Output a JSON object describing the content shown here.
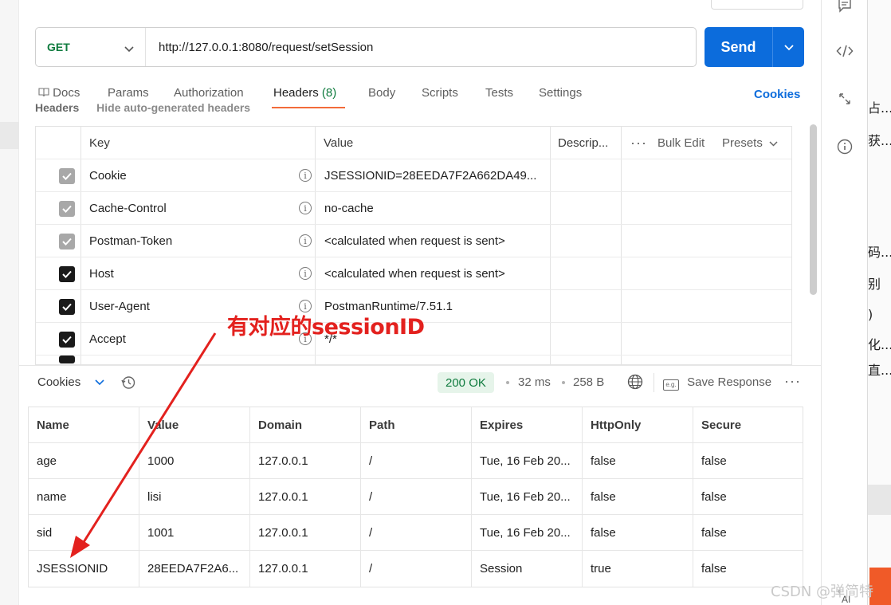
{
  "request": {
    "method": "GET",
    "url": "http://127.0.0.1:8080/request/setSession",
    "send_label": "Send"
  },
  "tabs": [
    {
      "label": "Docs"
    },
    {
      "label": "Params"
    },
    {
      "label": "Authorization"
    },
    {
      "label": "Headers",
      "count": "(8)"
    },
    {
      "label": "Body"
    },
    {
      "label": "Scripts"
    },
    {
      "label": "Tests"
    },
    {
      "label": "Settings"
    }
  ],
  "cookies_link": "Cookies",
  "headers_section": {
    "title": "Headers",
    "toggle_label": "Hide auto-generated headers"
  },
  "headers_table": {
    "columns": {
      "key": "Key",
      "value": "Value",
      "description": "Descrip...",
      "bulk_edit": "Bulk Edit",
      "presets": "Presets"
    },
    "rows": [
      {
        "key": "Cookie",
        "value": "JSESSIONID=28EEDA7F2A662DA49..."
      },
      {
        "key": "Cache-Control",
        "value": "no-cache"
      },
      {
        "key": "Postman-Token",
        "value": "<calculated when request is sent>"
      },
      {
        "key": "Host",
        "value": "<calculated when request is sent>"
      },
      {
        "key": "User-Agent",
        "value": "PostmanRuntime/7.51.1"
      },
      {
        "key": "Accept",
        "value": "*/*"
      }
    ]
  },
  "response_bar": {
    "tab": "Cookies",
    "status": "200 OK",
    "time": "32 ms",
    "size": "258 B",
    "save_label": "Save Response"
  },
  "cookies_table": {
    "columns": [
      "Name",
      "Value",
      "Domain",
      "Path",
      "Expires",
      "HttpOnly",
      "Secure"
    ],
    "rows": [
      [
        "age",
        "1000",
        "127.0.0.1",
        "/",
        "Tue, 16 Feb 20...",
        "false",
        "false"
      ],
      [
        "name",
        "lisi",
        "127.0.0.1",
        "/",
        "Tue, 16 Feb 20...",
        "false",
        "false"
      ],
      [
        "sid",
        "1001",
        "127.0.0.1",
        "/",
        "Tue, 16 Feb 20...",
        "false",
        "false"
      ],
      [
        "JSESSIONID",
        "28EEDA7F2A6...",
        "127.0.0.1",
        "/",
        "Session",
        "true",
        "false"
      ]
    ]
  },
  "annotation": "有对应的sessionID",
  "outer_strip": [
    "占...",
    "获...",
    "码...",
    "别",
    ")",
    "化...",
    "直..."
  ],
  "watermark": "CSDN @弹简特",
  "colors": {
    "accent": "#0c6cdc",
    "status_green": "#0f7b3e",
    "annotation_red": "#e3211e",
    "tab_underline": "#f26b3a"
  }
}
